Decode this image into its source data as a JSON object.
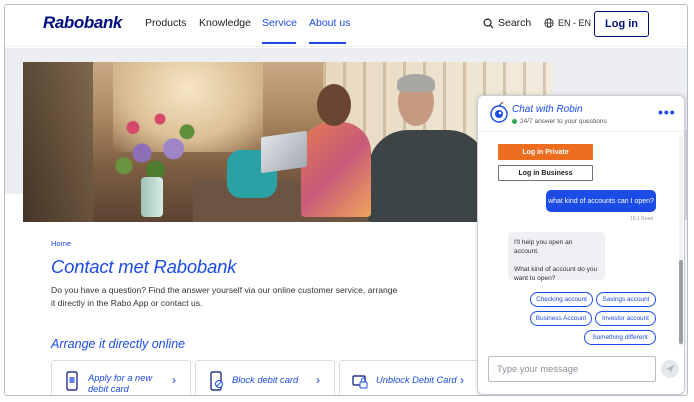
{
  "header": {
    "logo": "Rabobank",
    "nav": [
      {
        "label": "Products"
      },
      {
        "label": "Knowledge"
      },
      {
        "label": "Service"
      },
      {
        "label": "About us"
      }
    ],
    "search_label": "Search",
    "language": "EN - EN",
    "login_label": "Log in"
  },
  "page": {
    "breadcrumb": "Home",
    "title": "Contact met Rabobank",
    "intro": "Do you have a question? Find the answer yourself via our online customer service, arrange it directly in the Rabo App or contact us.",
    "subtitle": "Arrange it directly online",
    "cards": [
      {
        "label": "Apply for a new debit card",
        "icon": "phone-card-icon"
      },
      {
        "label": "Block debit card",
        "icon": "phone-block-icon"
      },
      {
        "label": "Unblock Debit Card",
        "icon": "card-unlock-icon"
      }
    ]
  },
  "chat": {
    "title": "Chat with Robin",
    "status": "24/7 answer to your questions",
    "login_private": "Log in Private",
    "login_business": "Log in Business",
    "user_message": "what kind of accounts can I open?",
    "read_receipt": "10:1 Read",
    "bot_line1": "I'll help you open an account.",
    "bot_line2": "What kind of account do you want to open?",
    "options": [
      {
        "label": "Checking account"
      },
      {
        "label": "Savings account"
      },
      {
        "label": "Business Account"
      },
      {
        "label": "Investor account"
      },
      {
        "label": "Something different"
      }
    ],
    "input_placeholder": "Type your message"
  },
  "colors": {
    "brand_navy": "#000f7d",
    "link_blue": "#1c4be6",
    "orange": "#ec6d1f"
  }
}
